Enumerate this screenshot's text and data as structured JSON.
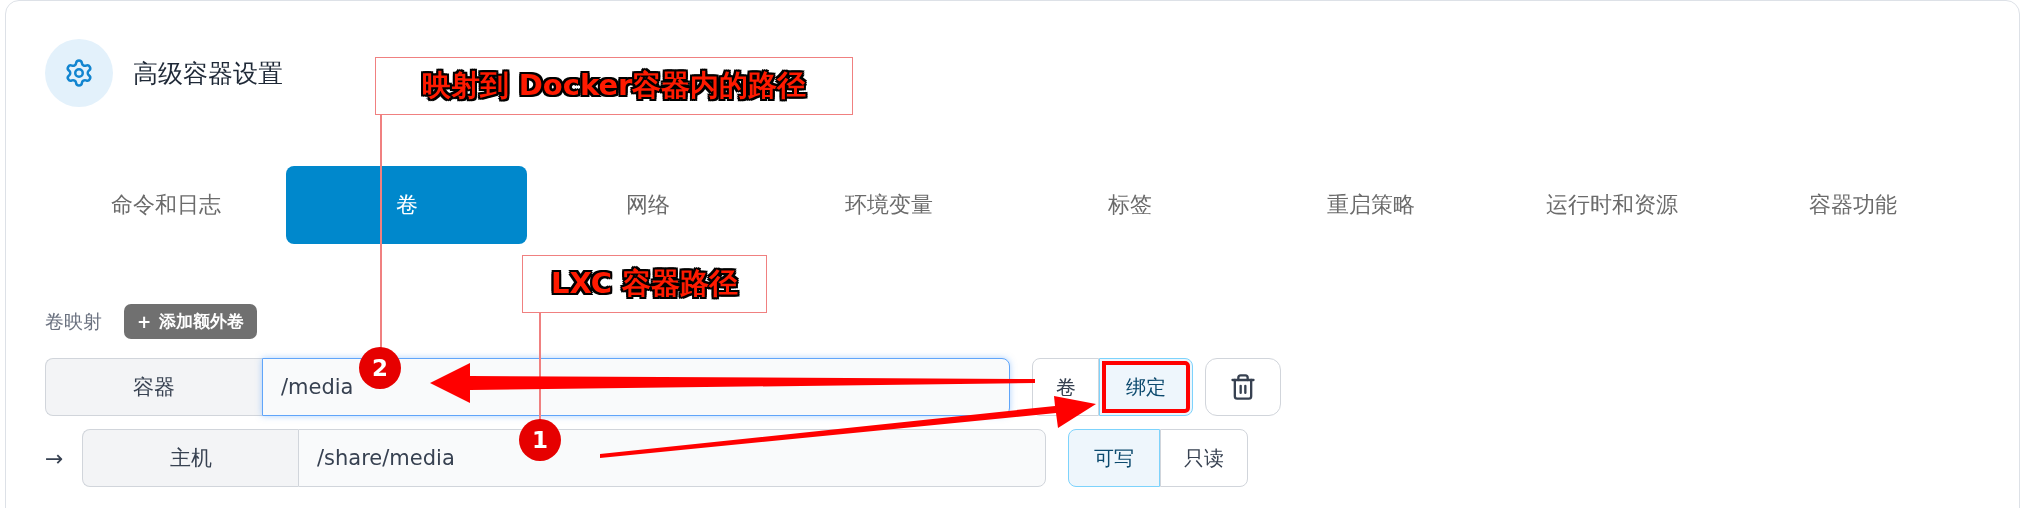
{
  "header": {
    "title": "高级容器设置"
  },
  "tabs": [
    {
      "label": "命令和日志",
      "selected": false
    },
    {
      "label": "卷",
      "selected": true
    },
    {
      "label": "网络",
      "selected": false
    },
    {
      "label": "环境变量",
      "selected": false
    },
    {
      "label": "标签",
      "selected": false
    },
    {
      "label": "重启策略",
      "selected": false
    },
    {
      "label": "运行时和资源",
      "selected": false
    },
    {
      "label": "容器功能",
      "selected": false
    }
  ],
  "volume_mappings": {
    "label": "卷映射",
    "add_button": {
      "icon": "+",
      "label": "添加额外卷"
    },
    "mappings": [
      {
        "container_label": "容器",
        "container_path": "/media",
        "type_options": [
          {
            "label": "卷",
            "selected": false,
            "highlighted": false
          },
          {
            "label": "绑定",
            "selected": true,
            "highlighted": true
          }
        ],
        "row_arrow": "→",
        "host_label": "主机",
        "host_path": "/share/media",
        "access_options": [
          {
            "label": "可写",
            "selected": true
          },
          {
            "label": "只读",
            "selected": false
          }
        ]
      }
    ]
  },
  "annotations": {
    "labels": [
      {
        "text": "映射到 Docker容器内的路径"
      },
      {
        "text": "LXC 容器路径"
      }
    ],
    "badges": [
      "2",
      "1"
    ]
  }
}
